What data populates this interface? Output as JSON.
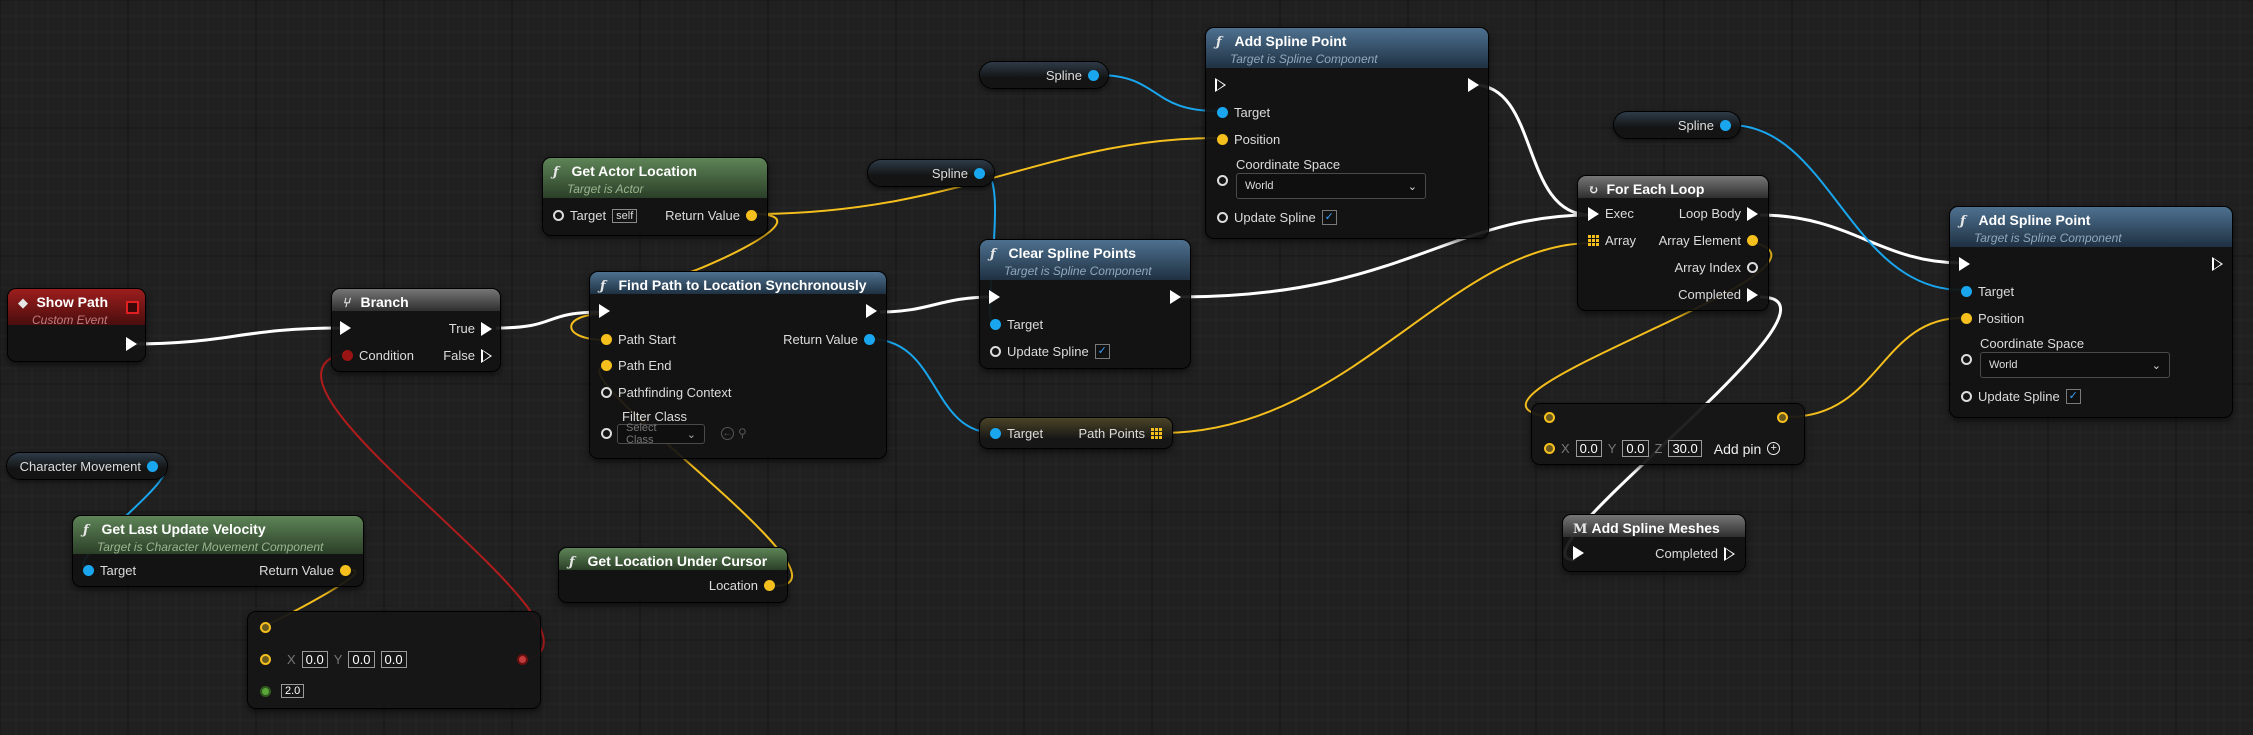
{
  "colors": {
    "exec": "#ffffff",
    "vector": "#f5bf1d",
    "object": "#1aa6ef",
    "bool": "#a51818",
    "integer": "#2fd0a5",
    "class": "#7a19c8",
    "float": "#5aa63a"
  },
  "show_path": {
    "title": "Show Path",
    "subtitle": "Custom Event"
  },
  "branch": {
    "title": "Branch",
    "condition": "Condition",
    "true": "True",
    "false": "False"
  },
  "get_actor_location": {
    "title": "Get Actor Location",
    "subtitle": "Target is Actor",
    "target": "Target",
    "self": "self",
    "return_value": "Return Value"
  },
  "find_path": {
    "title": "Find Path to Location Synchronously",
    "path_start": "Path Start",
    "path_end": "Path End",
    "pathfinding_context": "Pathfinding Context",
    "filter_class": "Filter Class",
    "select_class": "Select Class",
    "return_value": "Return Value"
  },
  "spline_var_1": "Spline",
  "spline_var_2": "Spline",
  "spline_var_3": "Spline",
  "clear_spline": {
    "title": "Clear Spline Points",
    "subtitle": "Target is Spline Component",
    "target": "Target",
    "update_spline": "Update Spline"
  },
  "add_spline_1": {
    "title": "Add Spline Point",
    "subtitle": "Target is Spline Component",
    "target": "Target",
    "position": "Position",
    "coordinate_space": "Coordinate Space",
    "world": "World",
    "update_spline": "Update Spline"
  },
  "path_points": {
    "target": "Target",
    "path_points": "Path Points"
  },
  "for_each": {
    "title": "For Each Loop",
    "exec": "Exec",
    "array": "Array",
    "loop_body": "Loop Body",
    "array_element": "Array Element",
    "array_index": "Array Index",
    "completed": "Completed"
  },
  "add_spline_2": {
    "title": "Add Spline Point",
    "subtitle": "Target is Spline Component",
    "target": "Target",
    "position": "Position",
    "coordinate_space": "Coordinate Space",
    "world": "World",
    "update_spline": "Update Spline"
  },
  "character_movement": "Character Movement",
  "get_velocity": {
    "title": "Get Last Update Velocity",
    "subtitle": "Target is Character Movement Component",
    "target": "Target",
    "return_value": "Return Value"
  },
  "get_cursor": {
    "title": "Get Location Under Cursor",
    "location": "Location"
  },
  "vector_node_1": {
    "x_label": "X",
    "x": "0.0",
    "y_label": "Y",
    "y": "0.0",
    "z": "0.0",
    "float": "2.0"
  },
  "vector_node_2": {
    "x_label": "X",
    "x": "0.0",
    "y_label": "Y",
    "y": "0.0",
    "z_label": "Z",
    "z": "30.0",
    "add_pin": "Add pin"
  },
  "add_meshes": {
    "title": "Add Spline Meshes",
    "completed": "Completed"
  }
}
